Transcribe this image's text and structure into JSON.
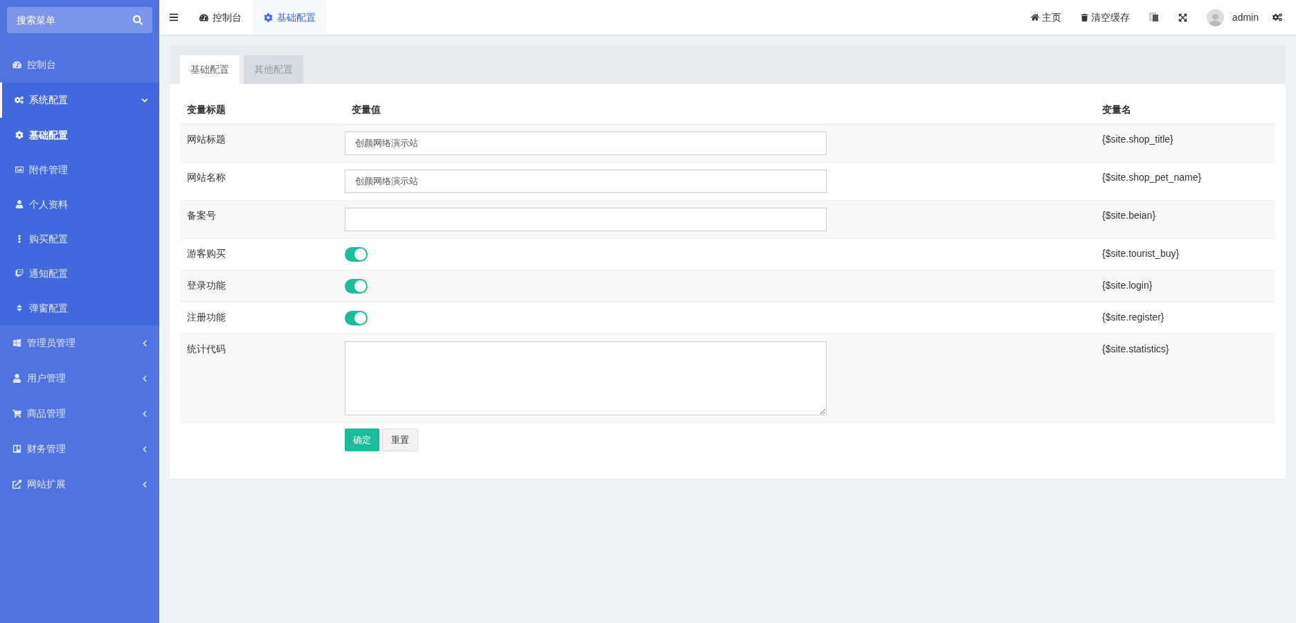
{
  "sidebar": {
    "search_placeholder": "搜索菜单",
    "items": [
      {
        "label": "控制台",
        "kind": "link"
      },
      {
        "label": "系统配置",
        "kind": "group",
        "expanded": true,
        "children": [
          {
            "label": "基础配置",
            "selected": true
          },
          {
            "label": "附件管理",
            "selected": false
          },
          {
            "label": "个人资料",
            "selected": false
          },
          {
            "label": "购买配置",
            "selected": false
          },
          {
            "label": "通知配置",
            "selected": false
          },
          {
            "label": "弹窗配置",
            "selected": false
          }
        ]
      },
      {
        "label": "管理员管理",
        "kind": "group",
        "expanded": false
      },
      {
        "label": "用户管理",
        "kind": "group",
        "expanded": false
      },
      {
        "label": "商品管理",
        "kind": "group",
        "expanded": false
      },
      {
        "label": "财务管理",
        "kind": "group",
        "expanded": false
      },
      {
        "label": "网站扩展",
        "kind": "group",
        "expanded": false
      }
    ]
  },
  "topbar": {
    "tabs": [
      {
        "label": "控制台",
        "selected": false
      },
      {
        "label": "基础配置",
        "selected": true
      }
    ],
    "links": [
      "主页",
      "清空缓存"
    ],
    "user": "admin"
  },
  "panel": {
    "tabs": [
      {
        "label": "基础配置",
        "selected": true
      },
      {
        "label": "其他配置",
        "selected": false
      }
    ],
    "columns": [
      "变量标题",
      "变量值",
      "变量名"
    ],
    "rows": [
      {
        "title": "网站标题",
        "kind": "input",
        "value": "创颜网络演示站",
        "variable": "{$site.shop_title}"
      },
      {
        "title": "网站名称",
        "kind": "input",
        "value": "创颜网络演示站",
        "variable": "{$site.shop_pet_name}"
      },
      {
        "title": "备案号",
        "kind": "input",
        "variable": "{$site.beian}"
      },
      {
        "title": "游客购买",
        "kind": "switch",
        "on": true,
        "variable": "{$site.tourist_buy}"
      },
      {
        "title": "登录功能",
        "kind": "switch",
        "on": true,
        "variable": "{$site.login}"
      },
      {
        "title": "注册功能",
        "kind": "switch",
        "on": true,
        "variable": "{$site.register}"
      },
      {
        "title": "统计代码",
        "kind": "textarea",
        "variable": "{$site.statistics}"
      }
    ],
    "buttons": [
      {
        "label": "确定",
        "kind": "primary"
      },
      {
        "label": "重置",
        "kind": "default"
      }
    ]
  }
}
